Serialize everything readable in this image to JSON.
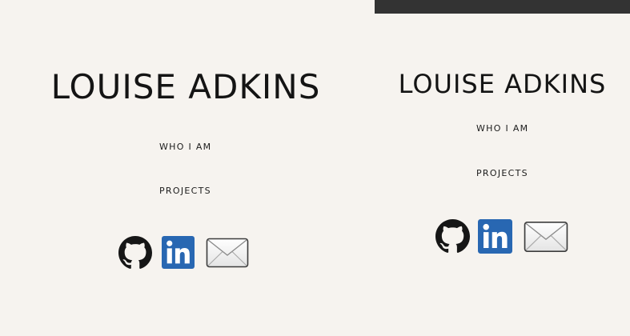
{
  "site": {
    "name": "LOUISE ADKINS"
  },
  "nav": {
    "who_i_am": "WHO I AM",
    "projects": "PROJECTS"
  },
  "social": {
    "github_icon": "github-icon",
    "linkedin_icon": "linkedin-icon",
    "email_icon": "envelope-icon"
  },
  "colors": {
    "background": "#f6f3ef",
    "topbar": "#333333",
    "text": "#141414",
    "linkedin_blue": "#2867b2"
  }
}
